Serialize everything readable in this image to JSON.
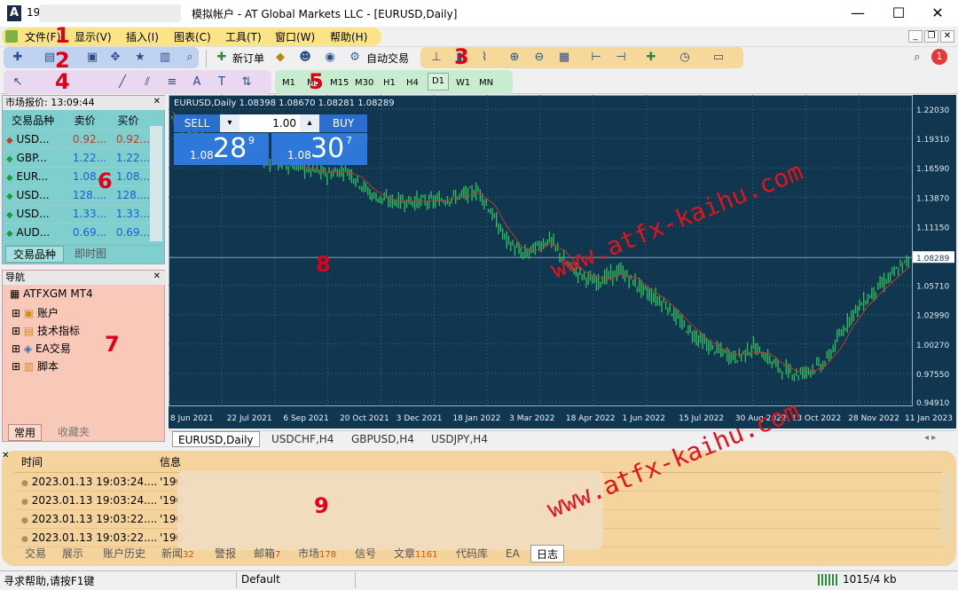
{
  "window": {
    "account_prefix": "190",
    "title": "模拟帐户 - AT Global Markets LLC - [EURUSD,Daily]"
  },
  "menu": [
    "文件(F)",
    "显示(V)",
    "插入(I)",
    "图表(C)",
    "工具(T)",
    "窗口(W)",
    "帮助(H)"
  ],
  "toolbar": {
    "new_order": "新订单",
    "auto_trade": "自动交易"
  },
  "timeframes": [
    "M1",
    "M5",
    "M15",
    "M30",
    "H1",
    "H4",
    "D1",
    "W1",
    "MN"
  ],
  "market_watch": {
    "header": "市场报价: 13:09:44",
    "columns": [
      "交易品种",
      "卖价",
      "买价"
    ],
    "rows": [
      {
        "symbol": "USD...",
        "bid": "0.92...",
        "ask": "0.92...",
        "dir": "down"
      },
      {
        "symbol": "GBP...",
        "bid": "1.22...",
        "ask": "1.22...",
        "dir": "up"
      },
      {
        "symbol": "EUR...",
        "bid": "1.08...",
        "ask": "1.08...",
        "dir": "up"
      },
      {
        "symbol": "USD...",
        "bid": "128....",
        "ask": "128....",
        "dir": "up"
      },
      {
        "symbol": "USD...",
        "bid": "1.33...",
        "ask": "1.33...",
        "dir": "up"
      },
      {
        "symbol": "AUD...",
        "bid": "0.69...",
        "ask": "0.69...",
        "dir": "up"
      }
    ],
    "tabs": [
      "交易品种",
      "即时图"
    ]
  },
  "navigator": {
    "header": "导航",
    "root": "ATFXGM MT4",
    "items": [
      "账户",
      "技术指标",
      "EA交易",
      "脚本"
    ],
    "tabs": [
      "常用",
      "收藏夹"
    ]
  },
  "chart": {
    "info": "EURUSD,Daily  1.08398 1.08670 1.08281 1.08289",
    "sell_label": "SELL",
    "buy_label": "BUY",
    "lot": "1.00",
    "sell_big": "28",
    "sell_small": "1.08",
    "sell_sup": "9",
    "buy_big": "30",
    "buy_small": "1.08",
    "buy_sup": "7",
    "price_labels": [
      "1.22030",
      "1.19310",
      "1.16590",
      "1.13870",
      "1.11150",
      "1.08289",
      "1.05710",
      "1.02990",
      "1.00270",
      "0.97550",
      "0.94910"
    ],
    "date_labels": [
      "8 Jun 2021",
      "22 Jul 2021",
      "6 Sep 2021",
      "20 Oct 2021",
      "3 Dec 2021",
      "18 Jan 2022",
      "3 Mar 2022",
      "18 Apr 2022",
      "1 Jun 2022",
      "15 Jul 2022",
      "30 Aug 2022",
      "13 Oct 2022",
      "28 Nov 2022",
      "11 Jan 2023"
    ],
    "tabs": [
      "EURUSD,Daily",
      "USDCHF,H4",
      "GBPUSD,H4",
      "USDJPY,H4"
    ],
    "colors": {
      "bg": "#11364f",
      "candle": "#2fc25b",
      "ma": "#c0392b",
      "grid": "#3f6a86"
    }
  },
  "terminal": {
    "columns": [
      "时间",
      "信息"
    ],
    "rows": [
      {
        "time": "2023.01.13 19:03:24....",
        "info": "'190"
      },
      {
        "time": "2023.01.13 19:03:24....",
        "info": "'190"
      },
      {
        "time": "2023.01.13 19:03:22....",
        "info": "'190"
      },
      {
        "time": "2023.01.13 19:03:22....",
        "info": "'190"
      }
    ],
    "tabs": [
      {
        "label": "交易",
        "count": ""
      },
      {
        "label": "展示",
        "count": ""
      },
      {
        "label": "账户历史",
        "count": ""
      },
      {
        "label": "新闻",
        "count": "32"
      },
      {
        "label": "警报",
        "count": ""
      },
      {
        "label": "邮箱",
        "count": "7"
      },
      {
        "label": "市场",
        "count": "178"
      },
      {
        "label": "信号",
        "count": ""
      },
      {
        "label": "文章",
        "count": "1161"
      },
      {
        "label": "代码库",
        "count": ""
      },
      {
        "label": "EA",
        "count": ""
      },
      {
        "label": "日志",
        "count": ""
      }
    ]
  },
  "status": {
    "help": "寻求帮助,请按F1键",
    "profile": "Default",
    "traffic": "1015/4 kb"
  },
  "notification_count": "1",
  "annotations": [
    "1",
    "2",
    "3",
    "4",
    "5",
    "6",
    "7",
    "8",
    "9"
  ],
  "watermark": "www.atfx-kaihu.com"
}
